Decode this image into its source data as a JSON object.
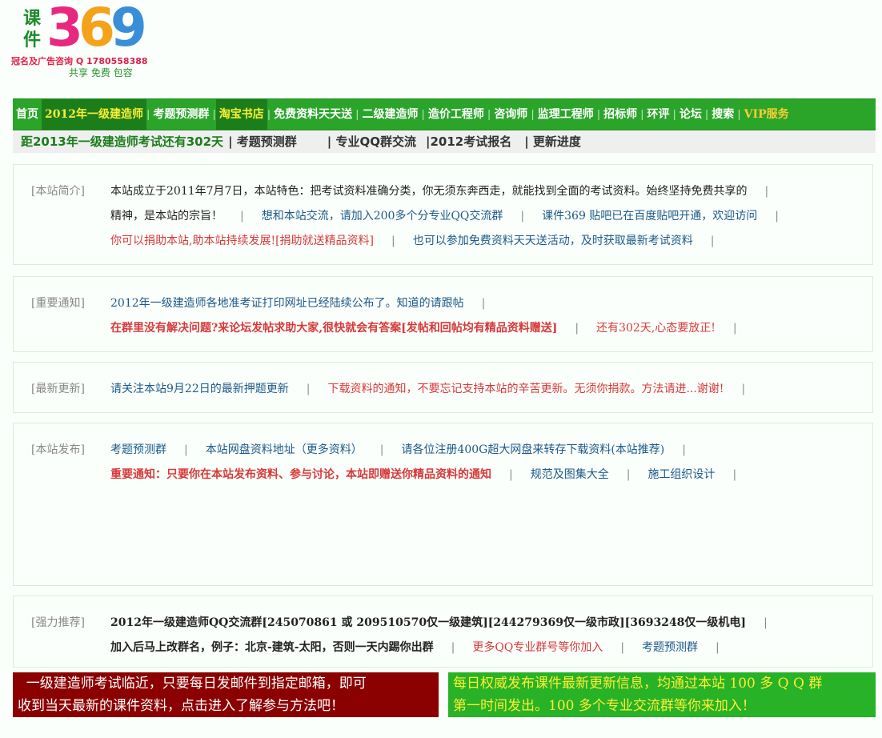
{
  "logo": {
    "chars": "课件",
    "digit1": "3",
    "digit2": "6",
    "digit3": "9",
    "ad": "冠名及广告咨询 Q 1780558388",
    "slogan": "共享  免费  包容"
  },
  "nav": {
    "items": [
      {
        "label": "首页"
      },
      {
        "label": "2012年一级建造师"
      },
      {
        "label": "考题预测群"
      },
      {
        "label": "淘宝书店"
      },
      {
        "label": "免费资料天天送"
      },
      {
        "label": "二级建造师"
      },
      {
        "label": "造价工程师"
      },
      {
        "label": "咨询师"
      },
      {
        "label": "监理工程师"
      },
      {
        "label": "招标师"
      },
      {
        "label": "环评"
      },
      {
        "label": "论坛"
      },
      {
        "label": "搜索"
      },
      {
        "label": "VIP服务"
      }
    ]
  },
  "subbar": {
    "countdown": "距2013年一级建造师考试还有302天",
    "item1": "| 考题预测群",
    "item2": "| 专业QQ群交流",
    "item3": "|2012考试报名",
    "item4": "| 更新进度"
  },
  "intro": {
    "tag": "[本站简介]",
    "l1": "本站成立于2011年7月7日，本站特色：把考试资料准确分类，你无须东奔西走，就能找到全面的考试资料。始终坚持免费共享的",
    "l2a": "精神，是本站的宗旨！",
    "l2b": "想和本站交流，请加入200多个分专业QQ交流群",
    "l2c": "课件369 贴吧已在百度贴吧开通，欢迎访问",
    "l3a": "你可以捐助本站,助本站持续发展![捐助就送精品资料]",
    "l3b": "也可以参加免费资料天天送活动，及时获取最新考试资料",
    "pipe": "|"
  },
  "notice": {
    "tag": "[重要通知]",
    "l1": "2012年一级建造师各地准考证打印网址已经陆续公布了。知道的请跟帖",
    "l2a": "在群里没有解决问题?来论坛发帖求助大家,很快就会有答案[发帖和回帖均有精品资料赠送]",
    "l2b": "还有302天,心态要放正!"
  },
  "updates": {
    "tag": "[最新更新]",
    "a": "请关注本站9月22日的最新押题更新",
    "b": "下载资料的通知，不要忘记支持本站的辛苦更新。无须你捐款。方法请进...谢谢!"
  },
  "publish": {
    "tag": "[本站发布]",
    "a": "考题预测群",
    "b": "本站网盘资料地址（更多资料）",
    "c": "请各位注册400G超大网盘来转存下载资料(本站推荐)",
    "d": "重要通知：只要你在本站发布资料、参与讨论，本站即赠送你精品资料的通知",
    "e": "规范及图集大全",
    "f": "施工组织设计"
  },
  "recommend": {
    "tag": "[强力推荐]",
    "a": "2012年一级建造师QQ交流群[245070861 或 209510570仅一级建筑][244279369仅一级市政][3693248仅一级机电]",
    "b": "加入后马上改群名，例子：北京-建筑-太阳，否则一天内踢你出群",
    "c": "更多QQ专业群号等你加入",
    "d": "考题预测群"
  },
  "banners": {
    "left1": "  一级建造师考试临近，只要每日发邮件到指定邮箱，即可",
    "left2": "收到当天最新的课件资料，点击进入了解参与方法吧！",
    "right1": "每日权威发布课件最新更新信息，均通过本站 100 多 Q Q 群",
    "right2": "第一时间发出。100 多个专业交流群等你来加入！"
  }
}
